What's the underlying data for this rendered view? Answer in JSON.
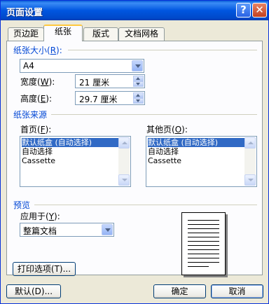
{
  "window": {
    "title": "页面设置",
    "help": "?",
    "close": "✕"
  },
  "tabs": [
    {
      "label": "页边距"
    },
    {
      "label": "纸张"
    },
    {
      "label": "版式"
    },
    {
      "label": "文档网格"
    }
  ],
  "paper_size": {
    "group_label": "纸张大小(",
    "group_key": "R",
    "group_suffix": "):",
    "selected": "A4",
    "width_label": "宽度(",
    "width_key": "W",
    "width_suffix": "):",
    "width_value": "21 厘米",
    "height_label": "高度(",
    "height_key": "E",
    "height_suffix": "):",
    "height_value": "29.7 厘米"
  },
  "paper_source": {
    "group_label": "纸张来源",
    "first_page_label": "首页(",
    "first_page_key": "F",
    "first_page_suffix": "):",
    "other_pages_label": "其他页(",
    "other_pages_key": "O",
    "other_pages_suffix": "):",
    "first_items": [
      "默认纸盒 (自动选择)",
      "自动选择",
      "Cassette"
    ],
    "other_items": [
      "默认纸盒 (自动选择)",
      "自动选择",
      "Cassette"
    ]
  },
  "preview": {
    "group_label": "预览",
    "apply_label": "应用于(",
    "apply_key": "Y",
    "apply_suffix": "):",
    "apply_value": "整篇文档"
  },
  "buttons": {
    "print_options": "打印选项(T)...",
    "default": "默认(D)...",
    "ok": "确定",
    "cancel": "取消"
  }
}
